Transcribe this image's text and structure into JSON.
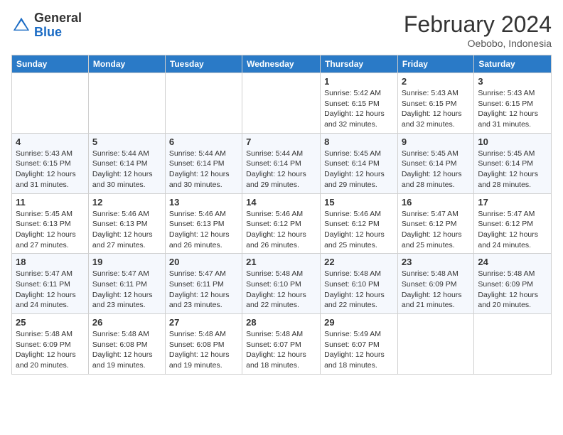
{
  "header": {
    "logo_general": "General",
    "logo_blue": "Blue",
    "month_title": "February 2024",
    "location": "Oebobo, Indonesia"
  },
  "weekdays": [
    "Sunday",
    "Monday",
    "Tuesday",
    "Wednesday",
    "Thursday",
    "Friday",
    "Saturday"
  ],
  "weeks": [
    [
      {
        "day": "",
        "info": ""
      },
      {
        "day": "",
        "info": ""
      },
      {
        "day": "",
        "info": ""
      },
      {
        "day": "",
        "info": ""
      },
      {
        "day": "1",
        "info": "Sunrise: 5:42 AM\nSunset: 6:15 PM\nDaylight: 12 hours and 32 minutes."
      },
      {
        "day": "2",
        "info": "Sunrise: 5:43 AM\nSunset: 6:15 PM\nDaylight: 12 hours and 32 minutes."
      },
      {
        "day": "3",
        "info": "Sunrise: 5:43 AM\nSunset: 6:15 PM\nDaylight: 12 hours and 31 minutes."
      }
    ],
    [
      {
        "day": "4",
        "info": "Sunrise: 5:43 AM\nSunset: 6:15 PM\nDaylight: 12 hours and 31 minutes."
      },
      {
        "day": "5",
        "info": "Sunrise: 5:44 AM\nSunset: 6:14 PM\nDaylight: 12 hours and 30 minutes."
      },
      {
        "day": "6",
        "info": "Sunrise: 5:44 AM\nSunset: 6:14 PM\nDaylight: 12 hours and 30 minutes."
      },
      {
        "day": "7",
        "info": "Sunrise: 5:44 AM\nSunset: 6:14 PM\nDaylight: 12 hours and 29 minutes."
      },
      {
        "day": "8",
        "info": "Sunrise: 5:45 AM\nSunset: 6:14 PM\nDaylight: 12 hours and 29 minutes."
      },
      {
        "day": "9",
        "info": "Sunrise: 5:45 AM\nSunset: 6:14 PM\nDaylight: 12 hours and 28 minutes."
      },
      {
        "day": "10",
        "info": "Sunrise: 5:45 AM\nSunset: 6:14 PM\nDaylight: 12 hours and 28 minutes."
      }
    ],
    [
      {
        "day": "11",
        "info": "Sunrise: 5:45 AM\nSunset: 6:13 PM\nDaylight: 12 hours and 27 minutes."
      },
      {
        "day": "12",
        "info": "Sunrise: 5:46 AM\nSunset: 6:13 PM\nDaylight: 12 hours and 27 minutes."
      },
      {
        "day": "13",
        "info": "Sunrise: 5:46 AM\nSunset: 6:13 PM\nDaylight: 12 hours and 26 minutes."
      },
      {
        "day": "14",
        "info": "Sunrise: 5:46 AM\nSunset: 6:12 PM\nDaylight: 12 hours and 26 minutes."
      },
      {
        "day": "15",
        "info": "Sunrise: 5:46 AM\nSunset: 6:12 PM\nDaylight: 12 hours and 25 minutes."
      },
      {
        "day": "16",
        "info": "Sunrise: 5:47 AM\nSunset: 6:12 PM\nDaylight: 12 hours and 25 minutes."
      },
      {
        "day": "17",
        "info": "Sunrise: 5:47 AM\nSunset: 6:12 PM\nDaylight: 12 hours and 24 minutes."
      }
    ],
    [
      {
        "day": "18",
        "info": "Sunrise: 5:47 AM\nSunset: 6:11 PM\nDaylight: 12 hours and 24 minutes."
      },
      {
        "day": "19",
        "info": "Sunrise: 5:47 AM\nSunset: 6:11 PM\nDaylight: 12 hours and 23 minutes."
      },
      {
        "day": "20",
        "info": "Sunrise: 5:47 AM\nSunset: 6:11 PM\nDaylight: 12 hours and 23 minutes."
      },
      {
        "day": "21",
        "info": "Sunrise: 5:48 AM\nSunset: 6:10 PM\nDaylight: 12 hours and 22 minutes."
      },
      {
        "day": "22",
        "info": "Sunrise: 5:48 AM\nSunset: 6:10 PM\nDaylight: 12 hours and 22 minutes."
      },
      {
        "day": "23",
        "info": "Sunrise: 5:48 AM\nSunset: 6:09 PM\nDaylight: 12 hours and 21 minutes."
      },
      {
        "day": "24",
        "info": "Sunrise: 5:48 AM\nSunset: 6:09 PM\nDaylight: 12 hours and 20 minutes."
      }
    ],
    [
      {
        "day": "25",
        "info": "Sunrise: 5:48 AM\nSunset: 6:09 PM\nDaylight: 12 hours and 20 minutes."
      },
      {
        "day": "26",
        "info": "Sunrise: 5:48 AM\nSunset: 6:08 PM\nDaylight: 12 hours and 19 minutes."
      },
      {
        "day": "27",
        "info": "Sunrise: 5:48 AM\nSunset: 6:08 PM\nDaylight: 12 hours and 19 minutes."
      },
      {
        "day": "28",
        "info": "Sunrise: 5:48 AM\nSunset: 6:07 PM\nDaylight: 12 hours and 18 minutes."
      },
      {
        "day": "29",
        "info": "Sunrise: 5:49 AM\nSunset: 6:07 PM\nDaylight: 12 hours and 18 minutes."
      },
      {
        "day": "",
        "info": ""
      },
      {
        "day": "",
        "info": ""
      }
    ]
  ]
}
